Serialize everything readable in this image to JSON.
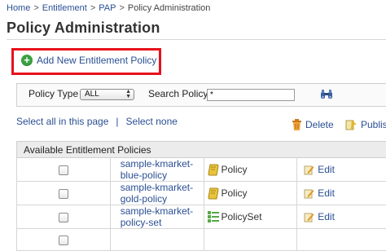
{
  "breadcrumb": {
    "items": [
      "Home",
      "Entitlement",
      "PAP",
      "Policy Administration"
    ],
    "separator": ">"
  },
  "page": {
    "title": "Policy Administration"
  },
  "actions": {
    "add_label": "Add New Entitlement Policy"
  },
  "filter": {
    "policy_type_label": "Policy Type",
    "policy_type_value": "ALL",
    "search_label": "Search Policy",
    "search_value": "*",
    "search_icon": "binoculars-icon"
  },
  "selection": {
    "select_all": "Select all in this page",
    "separator": "|",
    "select_none": "Select none"
  },
  "bulk_actions": {
    "delete_label": "Delete",
    "publish_label": "Publish"
  },
  "table": {
    "header": "Available Entitlement Policies",
    "rows": [
      {
        "name": "sample-kmarket-blue-policy",
        "type": "Policy",
        "type_icon": "policy-scroll-icon",
        "edit": "Edit"
      },
      {
        "name": "sample-kmarket-gold-policy",
        "type": "Policy",
        "type_icon": "policy-scroll-icon",
        "edit": "Edit"
      },
      {
        "name": "sample-kmarket-policy-set",
        "type": "PolicySet",
        "type_icon": "policyset-icon",
        "edit": "Edit"
      },
      {
        "name": "",
        "type": "",
        "type_icon": "",
        "edit": ""
      }
    ]
  },
  "colors": {
    "link": "#2a4f94",
    "highlight_border": "#e8111b",
    "add_icon": "#3aa140"
  }
}
